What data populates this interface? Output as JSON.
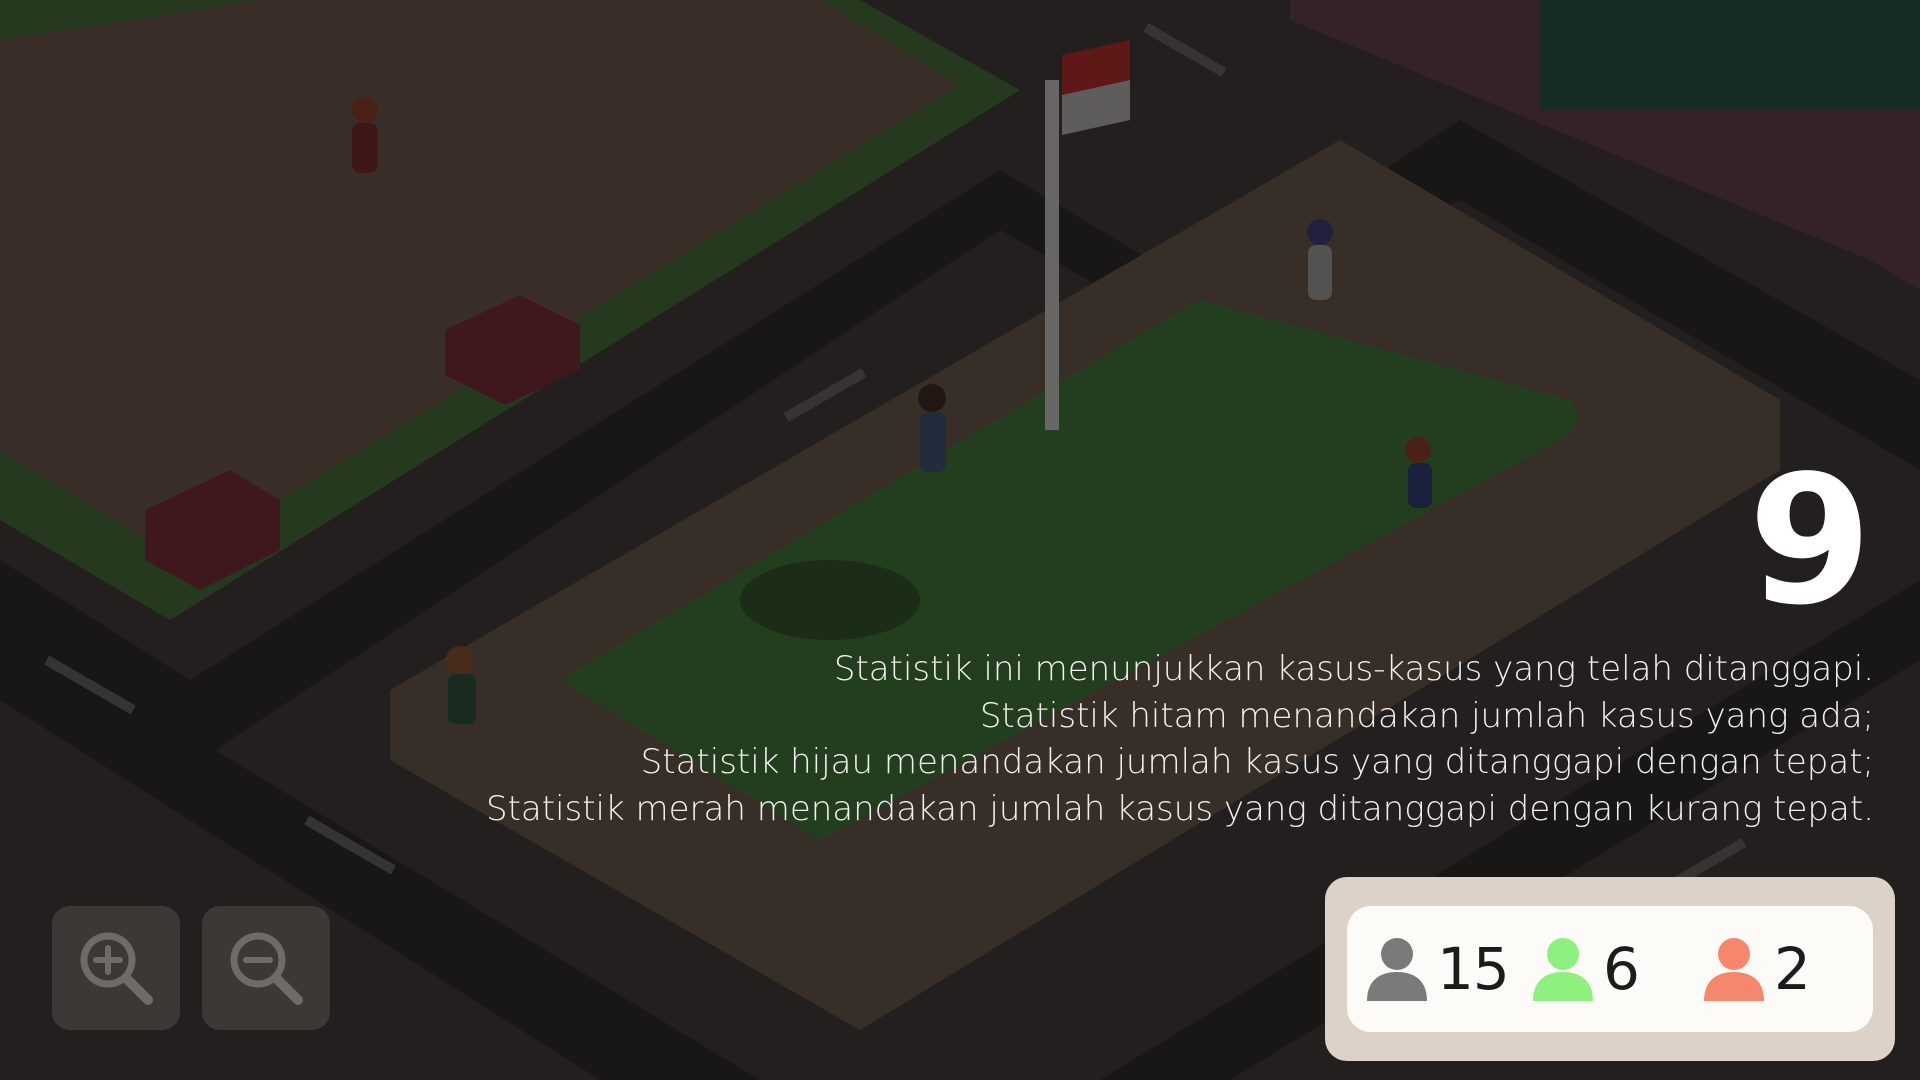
{
  "step": {
    "number": "9"
  },
  "explanation": {
    "lines": [
      "Statistik ini menunjukkan kasus-kasus yang telah ditanggapi.",
      "Statistik hitam menandakan jumlah kasus yang ada;",
      "Statistik hijau menandakan jumlah kasus yang ditanggapi dengan tepat;",
      "Statistik merah menandakan jumlah kasus yang ditanggapi dengan kurang tepat."
    ]
  },
  "stats": {
    "total": {
      "value": "15",
      "icon": "person-icon",
      "color": "#7a7a7a"
    },
    "correct": {
      "value": "6",
      "icon": "person-icon",
      "color": "#8ef07f"
    },
    "wrong": {
      "value": "2",
      "icon": "person-icon",
      "color": "#f5876d"
    }
  },
  "controls": {
    "zoom_in": {
      "icon": "zoom-in-icon"
    },
    "zoom_out": {
      "icon": "zoom-out-icon"
    }
  },
  "colors": {
    "overlay": "rgba(20,18,16,0.38)",
    "panel_outer": "#ddd2c7",
    "panel_inner": "#fdfbf8",
    "grass": "#2f5a2a",
    "sand": "#5a4a40",
    "road": "#1e1e1e"
  }
}
